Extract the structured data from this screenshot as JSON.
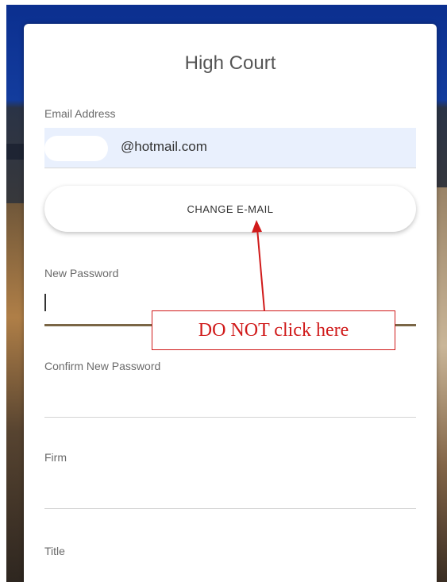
{
  "form": {
    "title": "High Court",
    "email_label": "Email Address",
    "email_value": "@hotmail.com",
    "change_email_label": "CHANGE E-MAIL",
    "new_password_label": "New Password",
    "confirm_password_label": "Confirm New Password",
    "firm_label": "Firm",
    "title_field_label": "Title"
  },
  "annotation": {
    "text": "DO NOT click here",
    "color": "#d01a1a"
  },
  "colors": {
    "header_blue": "#0b2f8f",
    "email_bg": "#e9f0fd",
    "focus_underline": "#7a6646"
  }
}
